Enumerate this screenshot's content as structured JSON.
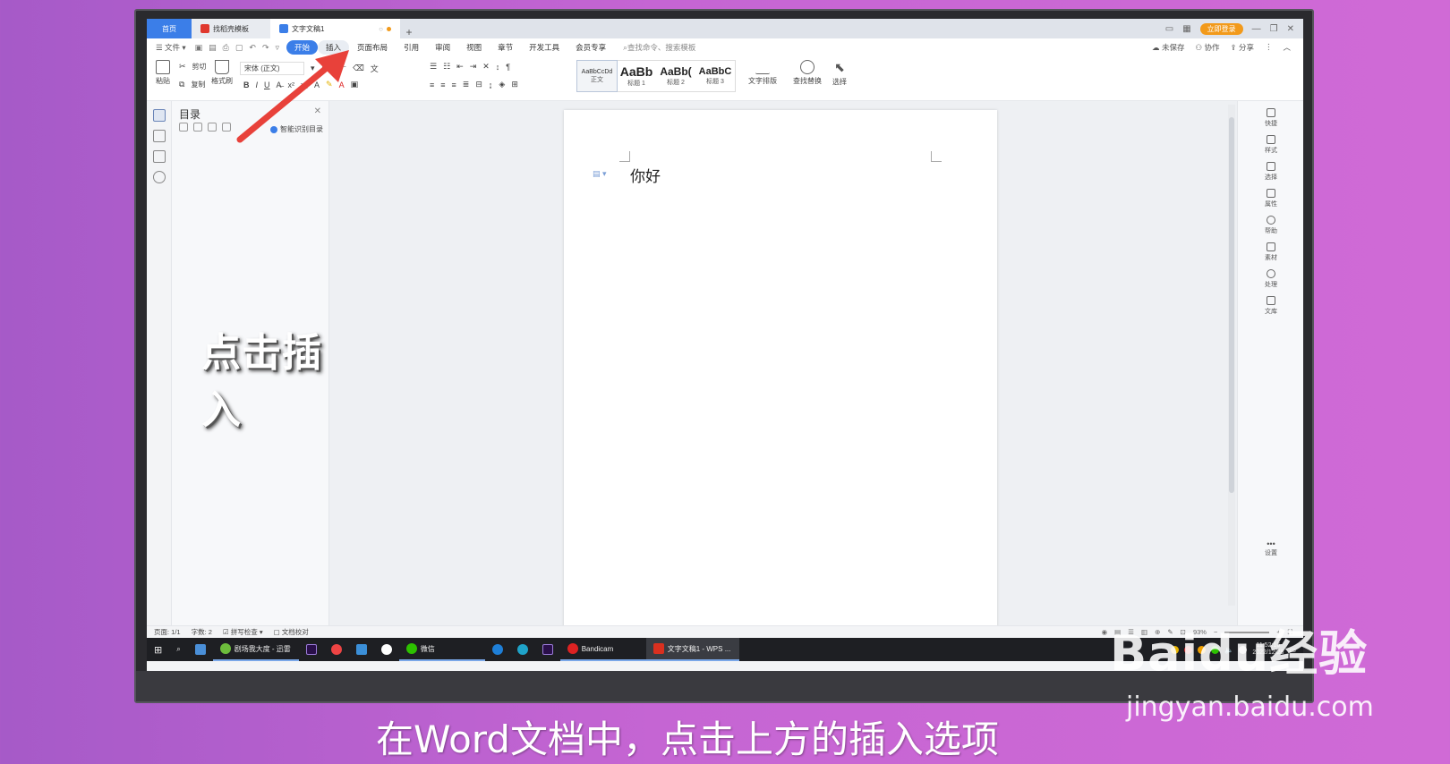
{
  "window": {
    "tabs": [
      {
        "label": "首页"
      },
      {
        "label": "找稻壳模板"
      },
      {
        "label": "文字文稿1"
      }
    ],
    "login_label": "立即登录"
  },
  "menu": {
    "file_label": "文件",
    "items": [
      "开始",
      "插入",
      "页面布局",
      "引用",
      "审阅",
      "视图",
      "章节",
      "开发工具",
      "会员专享"
    ],
    "active_item": "开始",
    "search_placeholder": "查找命令、搜索模板",
    "right": [
      "未保存",
      "协作",
      "分享"
    ]
  },
  "ribbon": {
    "paste": "粘贴",
    "cut": "剪切",
    "copy": "复制",
    "format_painter": "格式刷",
    "font_name": "宋体 (正文)",
    "styles": [
      {
        "preview": "AaBbCcDd",
        "label": "正文"
      },
      {
        "preview": "AaBb",
        "label": "标题 1"
      },
      {
        "preview": "AaBb(",
        "label": "标题 2"
      },
      {
        "preview": "AaBbC",
        "label": "标题 3"
      }
    ],
    "text_layout": "文字排版",
    "find_replace": "查找替换",
    "select": "选择"
  },
  "toc": {
    "title": "目录",
    "smart_label": "智能识别目录"
  },
  "overlay_caption": "点击插入",
  "document": {
    "text": "你好"
  },
  "right_sidebar": [
    "快捷",
    "样式",
    "选择",
    "属性",
    "帮助",
    "素材",
    "处理",
    "文库",
    "设置"
  ],
  "status": {
    "page": "页面: 1/1",
    "words": "字数: 2",
    "spell": "拼写检查",
    "proof": "文档校对",
    "zoom": "93%"
  },
  "taskbar": {
    "apps": [
      "剧场我大度 - 迅雷",
      "微信",
      "Bandicam",
      "文字文稿1 - WPS ..."
    ],
    "clock_time": "11:52:16",
    "clock_date": "2022/12/28"
  },
  "watermark": {
    "brand": "Baidu经验",
    "url": "jingyan.baidu.com"
  },
  "subtitle": "在Word文档中，点击上方的插入选项",
  "colors": {
    "accent": "#3b7ee8",
    "arrow": "#e8413a",
    "login": "#f29a1b"
  }
}
